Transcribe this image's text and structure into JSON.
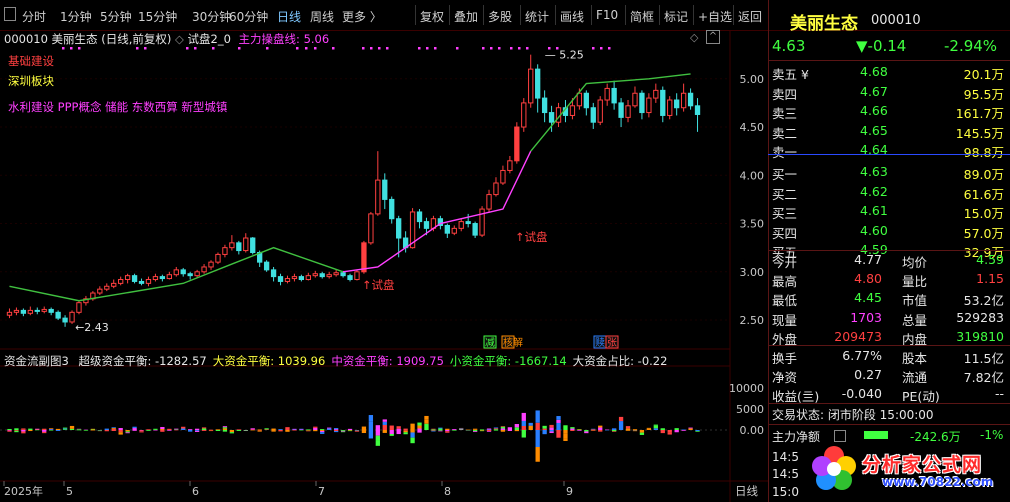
{
  "toolbar": {
    "left_items": [
      "分时",
      "1分钟",
      "5分钟",
      "15分钟",
      "30分钟",
      "60分钟",
      "日线",
      "周线",
      "更多 〉"
    ],
    "active": "日线",
    "right_items": [
      "复权",
      "叠加",
      "多股",
      "统计",
      "画线",
      "F10",
      "简框",
      "标记",
      "+自选",
      "返回"
    ]
  },
  "chart_header": {
    "code_name": "000010  美丽生态 (日线,前复权)",
    "indicator": "试盘2_0",
    "ma_label": "主力操盘线: 5.06",
    "sectors": [
      "基础建设",
      "深圳板块"
    ],
    "concepts": "水利建设 PPP概念 储能 东数西算 新型城镇"
  },
  "chart_annotations": {
    "high_label": "5.25",
    "low_label": "2.43",
    "signal_labels": [
      "↑试盘",
      "↑试盘"
    ],
    "badges": [
      "减",
      "核解",
      "赎",
      "张"
    ]
  },
  "price_axis": [
    "5.00",
    "4.50",
    "4.00",
    "3.50",
    "3.00",
    "2.50"
  ],
  "sub_header": {
    "title": "资金流副图3",
    "items": [
      {
        "label": "超级资金平衡: -1282.57",
        "color": "#e6e6e6"
      },
      {
        "label": "大资金平衡: 1039.96",
        "color": "#ffff40"
      },
      {
        "label": "中资金平衡: 1909.75",
        "color": "#ff40ff"
      },
      {
        "label": "小资金平衡: -1667.14",
        "color": "#40ff40"
      },
      {
        "label": "大资金占比: -0.22",
        "color": "#e6e6e6"
      }
    ]
  },
  "sub_axis": [
    "10000",
    "5000",
    "0.00"
  ],
  "time_axis": [
    "2025年",
    "5",
    "6",
    "7",
    "8",
    "9"
  ],
  "period_label": "日线",
  "quote": {
    "name": "美丽生态",
    "code": "000010",
    "price": "4.63",
    "change": "▼-0.14",
    "pct": "-2.94%"
  },
  "orderbook": {
    "sell": [
      {
        "label": "卖五 ¥",
        "price": "4.68",
        "vol": "20.1万",
        "color": "#40ff40"
      },
      {
        "label": "卖四",
        "price": "4.67",
        "vol": "95.5万",
        "color": "#40ff40"
      },
      {
        "label": "卖三",
        "price": "4.66",
        "vol": "161.7万",
        "color": "#40ff40"
      },
      {
        "label": "卖二",
        "price": "4.65",
        "vol": "145.5万",
        "color": "#40ff40"
      },
      {
        "label": "卖一",
        "price": "4.64",
        "vol": "98.8万",
        "color": "#40ff40"
      }
    ],
    "buy": [
      {
        "label": "买一",
        "price": "4.63",
        "vol": "89.0万",
        "color": "#40ff40"
      },
      {
        "label": "买二",
        "price": "4.62",
        "vol": "61.6万",
        "color": "#40ff40"
      },
      {
        "label": "买三",
        "price": "4.61",
        "vol": "15.0万",
        "color": "#40ff40"
      },
      {
        "label": "买四",
        "price": "4.60",
        "vol": "57.0万",
        "color": "#40ff40"
      },
      {
        "label": "买五",
        "price": "4.59",
        "vol": "32.9万",
        "color": "#40ff40"
      }
    ]
  },
  "stats": [
    {
      "l1": "今开",
      "v1": "4.77",
      "c1": "#e6e6e6",
      "l2": "均价",
      "v2": "4.59",
      "c2": "#40ff40"
    },
    {
      "l1": "最高",
      "v1": "4.80",
      "c1": "#ff4040",
      "l2": "量比",
      "v2": "1.15",
      "c2": "#ff4040"
    },
    {
      "l1": "最低",
      "v1": "4.45",
      "c1": "#40ff40",
      "l2": "市值",
      "v2": "53.2亿",
      "c2": "#e6e6e6"
    },
    {
      "l1": "现量",
      "v1": "1703",
      "c1": "#ff40ff",
      "l2": "总量",
      "v2": "529283",
      "c2": "#e6e6e6"
    },
    {
      "l1": "外盘",
      "v1": "209473",
      "c1": "#ff4040",
      "l2": "内盘",
      "v2": "319810",
      "c2": "#40ff40"
    }
  ],
  "stats2": [
    {
      "l1": "换手",
      "v1": "6.77%",
      "l2": "股本",
      "v2": "11.5亿"
    },
    {
      "l1": "净资",
      "v1": "0.27",
      "l2": "流通",
      "v2": "7.82亿"
    },
    {
      "l1": "收益(亖)",
      "v1": "-0.040",
      "l2": "PE(动)",
      "v2": "--"
    }
  ],
  "trade_status": "交易状态: 闭市阶段 15:00:00",
  "main_net": {
    "label": "主力净额",
    "value": "-242.6万",
    "pct": "-1%"
  },
  "ticks": [
    "14:5",
    "14:5",
    "15:0"
  ],
  "logo": {
    "text": "分析家公式网",
    "url": "www.70822.com"
  },
  "colors": {
    "up": "#ff4040",
    "down": "#40e0e0",
    "ma": "#ff40ff",
    "ma2": "#40c040",
    "green": "#40ff40",
    "yellow": "#ffff40",
    "orange": "#ff8c00",
    "bg": "#000000",
    "grid": "#3a0000"
  },
  "chart_data": {
    "type": "candlestick",
    "price_range": [
      2.2,
      5.35
    ],
    "candles": [
      [
        2.55,
        2.58,
        2.62,
        2.52
      ],
      [
        2.58,
        2.6,
        2.63,
        2.55
      ],
      [
        2.6,
        2.57,
        2.62,
        2.54
      ],
      [
        2.57,
        2.6,
        2.64,
        2.55
      ],
      [
        2.6,
        2.59,
        2.63,
        2.56
      ],
      [
        2.59,
        2.61,
        2.64,
        2.57
      ],
      [
        2.61,
        2.58,
        2.63,
        2.55
      ],
      [
        2.58,
        2.52,
        2.6,
        2.5
      ],
      [
        2.52,
        2.48,
        2.55,
        2.43
      ],
      [
        2.48,
        2.58,
        2.6,
        2.46
      ],
      [
        2.58,
        2.68,
        2.7,
        2.56
      ],
      [
        2.68,
        2.72,
        2.75,
        2.65
      ],
      [
        2.72,
        2.78,
        2.8,
        2.7
      ],
      [
        2.78,
        2.82,
        2.85,
        2.76
      ],
      [
        2.82,
        2.85,
        2.88,
        2.8
      ],
      [
        2.85,
        2.88,
        2.92,
        2.83
      ],
      [
        2.88,
        2.92,
        2.95,
        2.86
      ],
      [
        2.92,
        2.96,
        2.98,
        2.88
      ],
      [
        2.96,
        2.9,
        2.98,
        2.88
      ],
      [
        2.9,
        2.88,
        2.93,
        2.86
      ],
      [
        2.88,
        2.92,
        2.95,
        2.85
      ],
      [
        2.92,
        2.95,
        2.98,
        2.9
      ],
      [
        2.95,
        2.93,
        2.97,
        2.9
      ],
      [
        2.93,
        2.97,
        3.0,
        2.92
      ],
      [
        2.97,
        3.02,
        3.05,
        2.95
      ],
      [
        3.02,
        2.98,
        3.04,
        2.95
      ],
      [
        2.98,
        2.96,
        3.0,
        2.92
      ],
      [
        2.96,
        3.0,
        3.02,
        2.94
      ],
      [
        3.0,
        3.05,
        3.08,
        2.98
      ],
      [
        3.05,
        3.1,
        3.12,
        3.02
      ],
      [
        3.1,
        3.18,
        3.2,
        3.08
      ],
      [
        3.18,
        3.25,
        3.28,
        3.15
      ],
      [
        3.25,
        3.3,
        3.38,
        3.22
      ],
      [
        3.3,
        3.22,
        3.32,
        3.18
      ],
      [
        3.22,
        3.35,
        3.4,
        3.2
      ],
      [
        3.35,
        3.2,
        3.36,
        3.18
      ],
      [
        3.2,
        3.1,
        3.22,
        3.05
      ],
      [
        3.1,
        3.02,
        3.12,
        3.0
      ],
      [
        3.02,
        2.95,
        3.05,
        2.9
      ],
      [
        2.95,
        2.9,
        2.98,
        2.86
      ],
      [
        2.9,
        2.93,
        2.96,
        2.88
      ],
      [
        2.93,
        2.95,
        2.98,
        2.9
      ],
      [
        2.95,
        2.92,
        2.97,
        2.9
      ],
      [
        2.92,
        2.96,
        2.99,
        2.91
      ],
      [
        2.96,
        2.98,
        3.01,
        2.94
      ],
      [
        2.98,
        2.95,
        3.0,
        2.93
      ],
      [
        2.95,
        2.97,
        3.0,
        2.93
      ],
      [
        2.97,
        2.99,
        3.02,
        2.95
      ],
      [
        2.99,
        2.96,
        3.01,
        2.94
      ],
      [
        2.96,
        2.92,
        2.98,
        2.9
      ],
      [
        2.92,
        3.0,
        3.02,
        2.91
      ],
      [
        3.0,
        3.3,
        3.32,
        2.98
      ],
      [
        3.3,
        3.6,
        3.62,
        3.28
      ],
      [
        3.6,
        3.95,
        4.25,
        3.58
      ],
      [
        3.95,
        3.75,
        4.02,
        3.65
      ],
      [
        3.75,
        3.55,
        3.78,
        3.5
      ],
      [
        3.55,
        3.35,
        3.58,
        3.15
      ],
      [
        3.35,
        3.25,
        3.42,
        3.2
      ],
      [
        3.25,
        3.62,
        3.66,
        3.24
      ],
      [
        3.62,
        3.52,
        3.65,
        3.45
      ],
      [
        3.52,
        3.45,
        3.56,
        3.38
      ],
      [
        3.45,
        3.55,
        3.58,
        3.42
      ],
      [
        3.55,
        3.48,
        3.58,
        3.44
      ],
      [
        3.48,
        3.4,
        3.5,
        3.35
      ],
      [
        3.4,
        3.45,
        3.48,
        3.38
      ],
      [
        3.45,
        3.52,
        3.55,
        3.42
      ],
      [
        3.52,
        3.5,
        3.6,
        3.46
      ],
      [
        3.5,
        3.38,
        3.52,
        3.35
      ],
      [
        3.38,
        3.65,
        3.68,
        3.36
      ],
      [
        3.65,
        3.8,
        3.85,
        3.62
      ],
      [
        3.8,
        3.92,
        3.98,
        3.78
      ],
      [
        3.92,
        4.05,
        4.1,
        3.9
      ],
      [
        4.05,
        4.15,
        4.2,
        4.02
      ],
      [
        4.15,
        4.5,
        4.55,
        4.12
      ],
      [
        4.5,
        4.75,
        4.8,
        4.45
      ],
      [
        4.75,
        5.1,
        5.25,
        4.7
      ],
      [
        5.1,
        4.8,
        5.15,
        4.65
      ],
      [
        4.8,
        4.65,
        4.88,
        4.55
      ],
      [
        4.65,
        4.55,
        4.72,
        4.45
      ],
      [
        4.55,
        4.7,
        4.75,
        4.5
      ],
      [
        4.7,
        4.62,
        4.78,
        4.55
      ],
      [
        4.62,
        4.72,
        4.8,
        4.58
      ],
      [
        4.72,
        4.85,
        4.9,
        4.68
      ],
      [
        4.85,
        4.7,
        4.88,
        4.62
      ],
      [
        4.7,
        4.55,
        4.75,
        4.48
      ],
      [
        4.55,
        4.78,
        4.82,
        4.52
      ],
      [
        4.78,
        4.9,
        4.95,
        4.72
      ],
      [
        4.9,
        4.75,
        4.98,
        4.68
      ],
      [
        4.75,
        4.6,
        4.8,
        4.5
      ],
      [
        4.6,
        4.72,
        4.78,
        4.55
      ],
      [
        4.72,
        4.85,
        4.92,
        4.7
      ],
      [
        4.85,
        4.65,
        4.88,
        4.58
      ],
      [
        4.65,
        4.8,
        4.85,
        4.6
      ],
      [
        4.8,
        4.88,
        4.95,
        4.75
      ],
      [
        4.88,
        4.62,
        4.92,
        4.55
      ],
      [
        4.62,
        4.78,
        4.82,
        4.58
      ],
      [
        4.78,
        4.7,
        4.85,
        4.62
      ],
      [
        4.7,
        4.85,
        4.95,
        4.66
      ],
      [
        4.85,
        4.72,
        4.9,
        4.68
      ],
      [
        4.72,
        4.63,
        4.8,
        4.45
      ]
    ],
    "ma_line": [
      [
        0,
        2.85
      ],
      [
        10,
        2.7
      ],
      [
        25,
        2.88
      ],
      [
        32,
        3.08
      ],
      [
        38,
        3.25
      ],
      [
        48,
        3.0
      ],
      [
        53,
        3.05
      ],
      [
        62,
        3.5
      ],
      [
        71,
        3.65
      ],
      [
        75,
        4.25
      ],
      [
        83,
        4.95
      ],
      [
        92,
        5.0
      ],
      [
        98,
        5.05
      ]
    ],
    "ma_color_split": [
      51,
      76
    ]
  }
}
